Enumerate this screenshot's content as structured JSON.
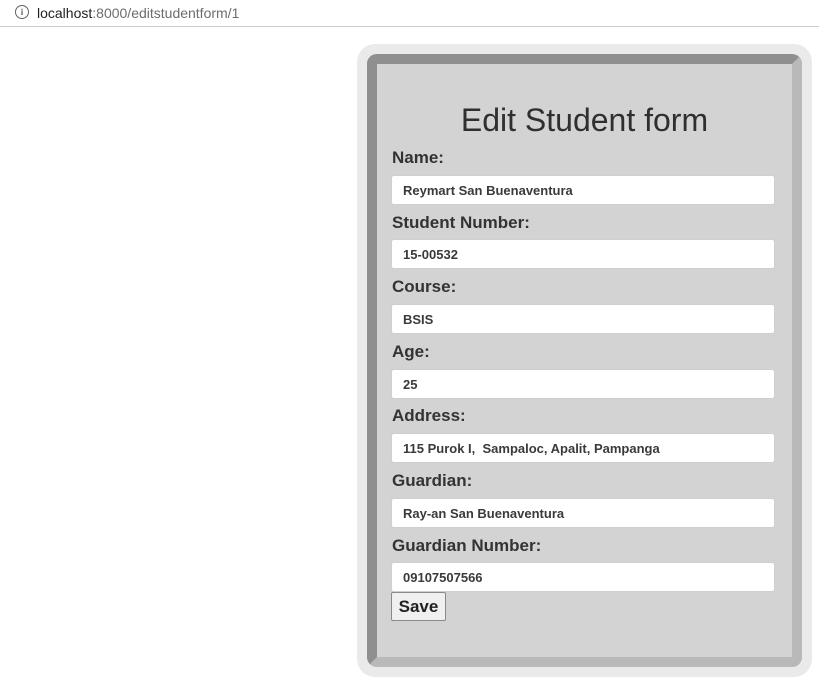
{
  "browser": {
    "url_host": "localhost",
    "url_rest": ":8000/editstudentform/1"
  },
  "form": {
    "title": "Edit Student form",
    "fields": [
      {
        "label": "Name:",
        "value": "Reymart San Buenaventura"
      },
      {
        "label": "Student Number:",
        "value": "15-00532"
      },
      {
        "label": "Course:",
        "value": "BSIS"
      },
      {
        "label": "Age:",
        "value": "25"
      },
      {
        "label": "Address:",
        "value": "115 Purok I,  Sampaloc, Apalit, Pampanga"
      },
      {
        "label": "Guardian:",
        "value": "Ray-an San Buenaventura"
      },
      {
        "label": "Guardian Number:",
        "value": "09107507566"
      }
    ],
    "save_label": "Save"
  }
}
